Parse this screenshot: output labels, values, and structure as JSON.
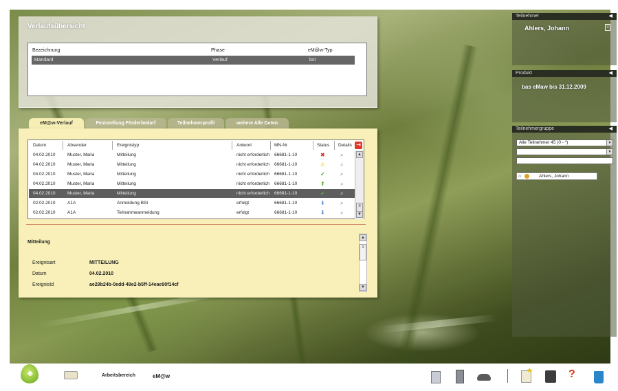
{
  "overview": {
    "title": "Verlaufsübersicht",
    "headers": [
      "Bezeichnung",
      "Phase",
      "eM@w-Typ"
    ],
    "rows": [
      [
        "Standard",
        "Verlauf",
        "bst"
      ]
    ]
  },
  "tabs": [
    "eM@w-Verlauf",
    "Feststellung Förderbedarf",
    "Teilnehmerprofil",
    "weitere Alle Daten"
  ],
  "events": {
    "headers": [
      "Datum",
      "Absender",
      "Ereignistyp",
      "Antwort",
      "MN-Nr",
      "Status",
      "Details"
    ],
    "rows": [
      [
        "04.02.2010",
        "Muster, Maria",
        "Mitteilung",
        "nicht erforderlich",
        "66681-1-10",
        "error"
      ],
      [
        "04.02.2010",
        "Muster, Maria",
        "Mitteilung",
        "nicht erforderlich",
        "66681-1-10",
        "warning"
      ],
      [
        "04.02.2010",
        "Muster, Maria",
        "Mitteilung",
        "nicht erforderlich",
        "66681-1-10",
        "ok"
      ],
      [
        "04.02.2010",
        "Muster, Maria",
        "Mitteilung",
        "nicht erforderlich",
        "66681-1-10",
        "up"
      ],
      [
        "04.02.2010",
        "Muster, Maria",
        "Mitteilung",
        "nicht erforderlich",
        "66681-1-10",
        "ok"
      ],
      [
        "02.02.2010",
        "A1A",
        "Anmeldung BSt",
        "erfolgt",
        "66681-1-10",
        "down"
      ],
      [
        "02.02.2010",
        "A1A",
        "Teilnahmeanmeldung",
        "erfolgt",
        "66681-1-10",
        "down"
      ]
    ],
    "selected_row": 4
  },
  "detail": {
    "title": "Mitteilung",
    "fields": [
      {
        "label": "Ereignisart",
        "value": "MITTEILUNG"
      },
      {
        "label": "Datum",
        "value": "04.02.2010"
      },
      {
        "label": "EreignisId",
        "value": "ae29b24b-0edd-48e2-b5ff-14eae90f14cf"
      }
    ]
  },
  "sidebar": {
    "participant": {
      "header": "Teilnehmer",
      "name": "Ahlers, Johann"
    },
    "product": {
      "header": "Produkt",
      "value": "bas eMaw  bis 31.12.2009"
    },
    "group": {
      "header": "Teilnehmergruppe",
      "select1": "Alle Teilnehmer 45 (0 - *)",
      "select2": "",
      "input": "",
      "member": "Ahlers, Johann"
    }
  },
  "taskbar": {
    "arbeitsbereich": "Arbeitsbereich",
    "emaw": "eM@w"
  },
  "colors": {
    "panel_yellow": "#f8f0b8",
    "selected_row": "#5e5e5e",
    "error": "#d62b1f",
    "warning": "#e8b800",
    "ok": "#5fb030",
    "arrow": "#6a8ed0"
  }
}
